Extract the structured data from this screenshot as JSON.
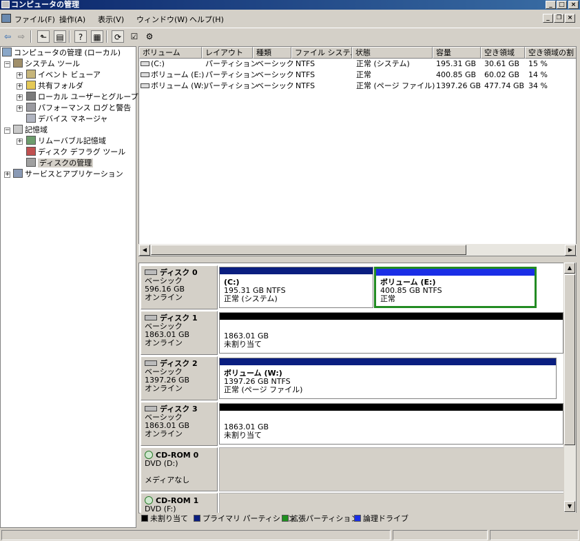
{
  "window": {
    "title": "コンピュータの管理"
  },
  "menu": [
    "ファイル(F)",
    "操作(A)",
    "表示(V)",
    "ウィンドウ(W)",
    "ヘルプ(H)"
  ],
  "caption_buttons": [
    "_",
    "□",
    "×"
  ],
  "mdi_buttons": [
    "_",
    "❐",
    "×"
  ],
  "toolbar_icons": [
    "back-arrow-icon",
    "forward-arrow-icon",
    "up-folder-icon",
    "show-hide-tree-icon",
    "properties-icon",
    "help-icon",
    "refresh-icon",
    "export-icon",
    "settings-icon"
  ],
  "tree": {
    "root": "コンピュータの管理 (ローカル)",
    "items": [
      {
        "label": "システム ツール",
        "level": 1,
        "expander": "−"
      },
      {
        "label": "イベント ビューア",
        "level": 2,
        "expander": "+"
      },
      {
        "label": "共有フォルダ",
        "level": 2,
        "expander": "+"
      },
      {
        "label": "ローカル ユーザーとグループ",
        "level": 2,
        "expander": "+"
      },
      {
        "label": "パフォーマンス ログと警告",
        "level": 2,
        "expander": "+"
      },
      {
        "label": "デバイス マネージャ",
        "level": 2,
        "expander": ""
      },
      {
        "label": "記憶域",
        "level": 1,
        "expander": "−"
      },
      {
        "label": "リムーバブル記憶域",
        "level": 2,
        "expander": "+"
      },
      {
        "label": "ディスク デフラグ ツール",
        "level": 2,
        "expander": ""
      },
      {
        "label": "ディスクの管理",
        "level": 2,
        "expander": ""
      },
      {
        "label": "サービスとアプリケーション",
        "level": 1,
        "expander": "+"
      }
    ]
  },
  "volume_list": {
    "columns": [
      "ボリューム",
      "レイアウト",
      "種類",
      "ファイル システム",
      "状態",
      "容量",
      "空き領域",
      "空き領域の割"
    ],
    "rows": [
      [
        "(C:)",
        "パーティション",
        "ベーシック",
        "NTFS",
        "正常 (システム)",
        "195.31 GB",
        "30.61 GB",
        "15 %"
      ],
      [
        "ボリューム (E:)",
        "パーティション",
        "ベーシック",
        "NTFS",
        "正常",
        "400.85 GB",
        "60.02 GB",
        "14 %"
      ],
      [
        "ボリューム (W:)",
        "パーティション",
        "ベーシック",
        "NTFS",
        "正常 (ページ ファイル)",
        "1397.26 GB",
        "477.74 GB",
        "34 %"
      ]
    ]
  },
  "disks": [
    {
      "name": "ディスク 0",
      "type": "ベーシック",
      "size": "596.16 GB",
      "status": "オンライン",
      "partitions": [
        {
          "name": "(C:)",
          "detail": "195.31 GB NTFS",
          "status": "正常 (システム)",
          "kind": "primary"
        },
        {
          "name": "ボリューム (E:)",
          "detail": "400.85 GB NTFS",
          "status": "正常",
          "kind": "primary",
          "selected": true
        }
      ]
    },
    {
      "name": "ディスク 1",
      "type": "ベーシック",
      "size": "1863.01 GB",
      "status": "オンライン",
      "partitions": [
        {
          "name": "",
          "detail": "1863.01 GB",
          "status": "未割り当て",
          "kind": "unallocated"
        }
      ]
    },
    {
      "name": "ディスク 2",
      "type": "ベーシック",
      "size": "1397.26 GB",
      "status": "オンライン",
      "partitions": [
        {
          "name": "ボリューム (W:)",
          "detail": "1397.26 GB NTFS",
          "status": "正常 (ページ ファイル)",
          "kind": "primary"
        }
      ]
    },
    {
      "name": "ディスク 3",
      "type": "ベーシック",
      "size": "1863.01 GB",
      "status": "オンライン",
      "partitions": [
        {
          "name": "",
          "detail": "1863.01 GB",
          "status": "未割り当て",
          "kind": "unallocated"
        }
      ]
    }
  ],
  "cdroms": [
    {
      "name": "CD-ROM 0",
      "drive": "DVD (D:)",
      "media": "メディアなし"
    },
    {
      "name": "CD-ROM 1",
      "drive": "DVD (F:)",
      "media": ""
    }
  ],
  "legend": [
    {
      "label": "未割り当て",
      "color": "#000000"
    },
    {
      "label": "プライマリ パーティション",
      "color": "#0a1e80"
    },
    {
      "label": "拡張パーティション",
      "color": "#1f8f1f"
    },
    {
      "label": "論理ドライブ",
      "color": "#1a2ee6"
    }
  ],
  "colors": {
    "title_start": "#0a246a",
    "title_end": "#3a6ea5",
    "selection_border": "#228b22"
  }
}
